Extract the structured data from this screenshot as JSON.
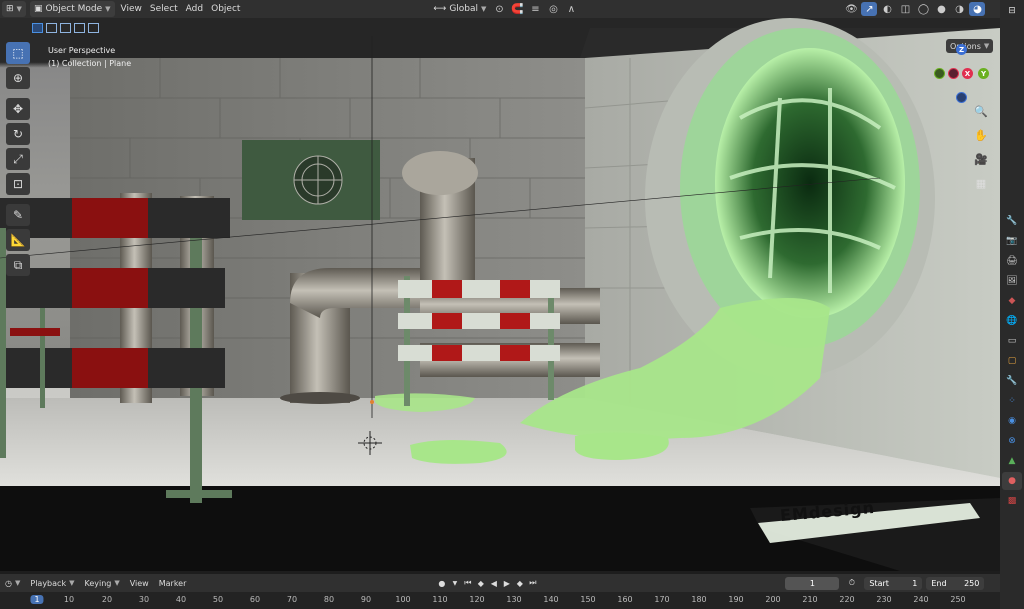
{
  "header": {
    "mode": "Object Mode",
    "menus": [
      "View",
      "Select",
      "Add",
      "Object"
    ],
    "transform_orientation": "Global"
  },
  "viewport": {
    "perspective_label": "User Perspective",
    "collection_label": "(1) Collection | Plane",
    "options_label": "Options",
    "gizmo": {
      "z": "Z",
      "x": "X",
      "y": "Y"
    },
    "watermark": "EMdesign"
  },
  "toolbar": {
    "tools": [
      "select-box",
      "cursor",
      "move",
      "rotate",
      "scale",
      "transform",
      "annotate",
      "measure",
      "add-cube"
    ]
  },
  "timeline": {
    "playback_label": "Playback",
    "keying_label": "Keying",
    "view_label": "View",
    "marker_label": "Marker",
    "current_frame": "1",
    "start_label": "Start",
    "start_value": "1",
    "end_label": "End",
    "end_value": "250",
    "ticks": [
      "1",
      "10",
      "20",
      "30",
      "40",
      "50",
      "60",
      "70",
      "80",
      "90",
      "100",
      "110",
      "120",
      "130",
      "140",
      "150",
      "160",
      "170",
      "180",
      "190",
      "200",
      "210",
      "220",
      "230",
      "240",
      "250"
    ]
  },
  "colors": {
    "accent": "#4772b3",
    "slime": "#a8e68a",
    "barrier_red": "#b01818"
  }
}
